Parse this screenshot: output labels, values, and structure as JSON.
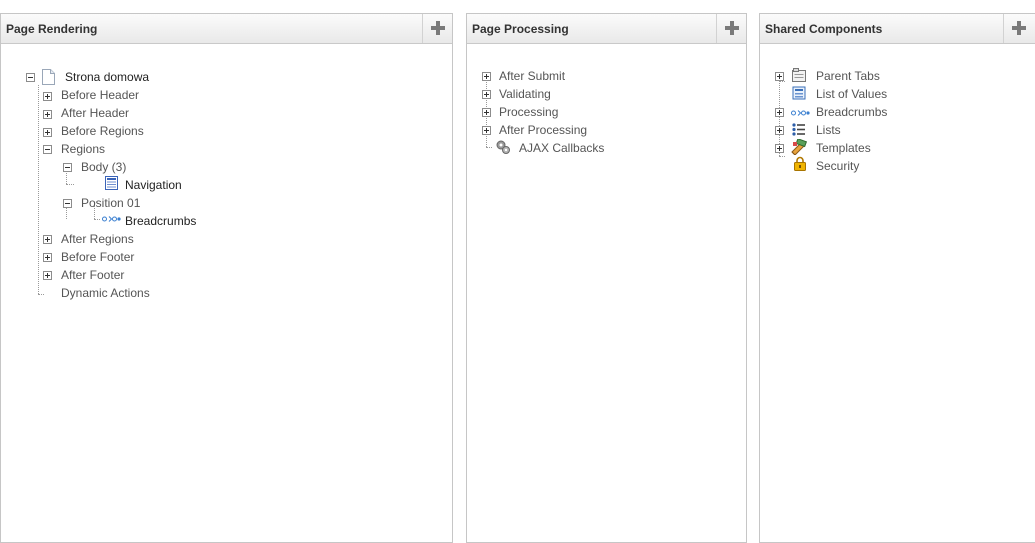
{
  "panels": {
    "page_rendering": {
      "title": "Page Rendering",
      "add_icon": "plus-icon",
      "page": {
        "label": "Strona domowa",
        "icon": "page-icon"
      },
      "items": {
        "before_header": "Before Header",
        "after_header": "After Header",
        "before_regions": "Before Regions",
        "regions": "Regions",
        "body": "Body (3)",
        "navigation": "Navigation",
        "position01": "Position 01",
        "breadcrumbs": "Breadcrumbs",
        "after_regions": "After Regions",
        "before_footer": "Before Footer",
        "after_footer": "After Footer",
        "dynamic_actions": "Dynamic Actions"
      }
    },
    "page_processing": {
      "title": "Page Processing",
      "add_icon": "plus-icon",
      "items": {
        "after_submit": "After Submit",
        "validating": "Validating",
        "processing": "Processing",
        "after_processing": "After Processing",
        "ajax_callbacks": "AJAX Callbacks"
      }
    },
    "shared_components": {
      "title": "Shared Components",
      "add_icon": "plus-icon",
      "items": {
        "parent_tabs": "Parent Tabs",
        "list_of_values": "List of Values",
        "breadcrumbs": "Breadcrumbs",
        "lists": "Lists",
        "templates": "Templates",
        "security": "Security"
      }
    }
  },
  "colors": {
    "add_icon": "#7a7a7a",
    "breadcrumb_icon": "#3a7fd0",
    "security_icon": "#f0b400"
  }
}
